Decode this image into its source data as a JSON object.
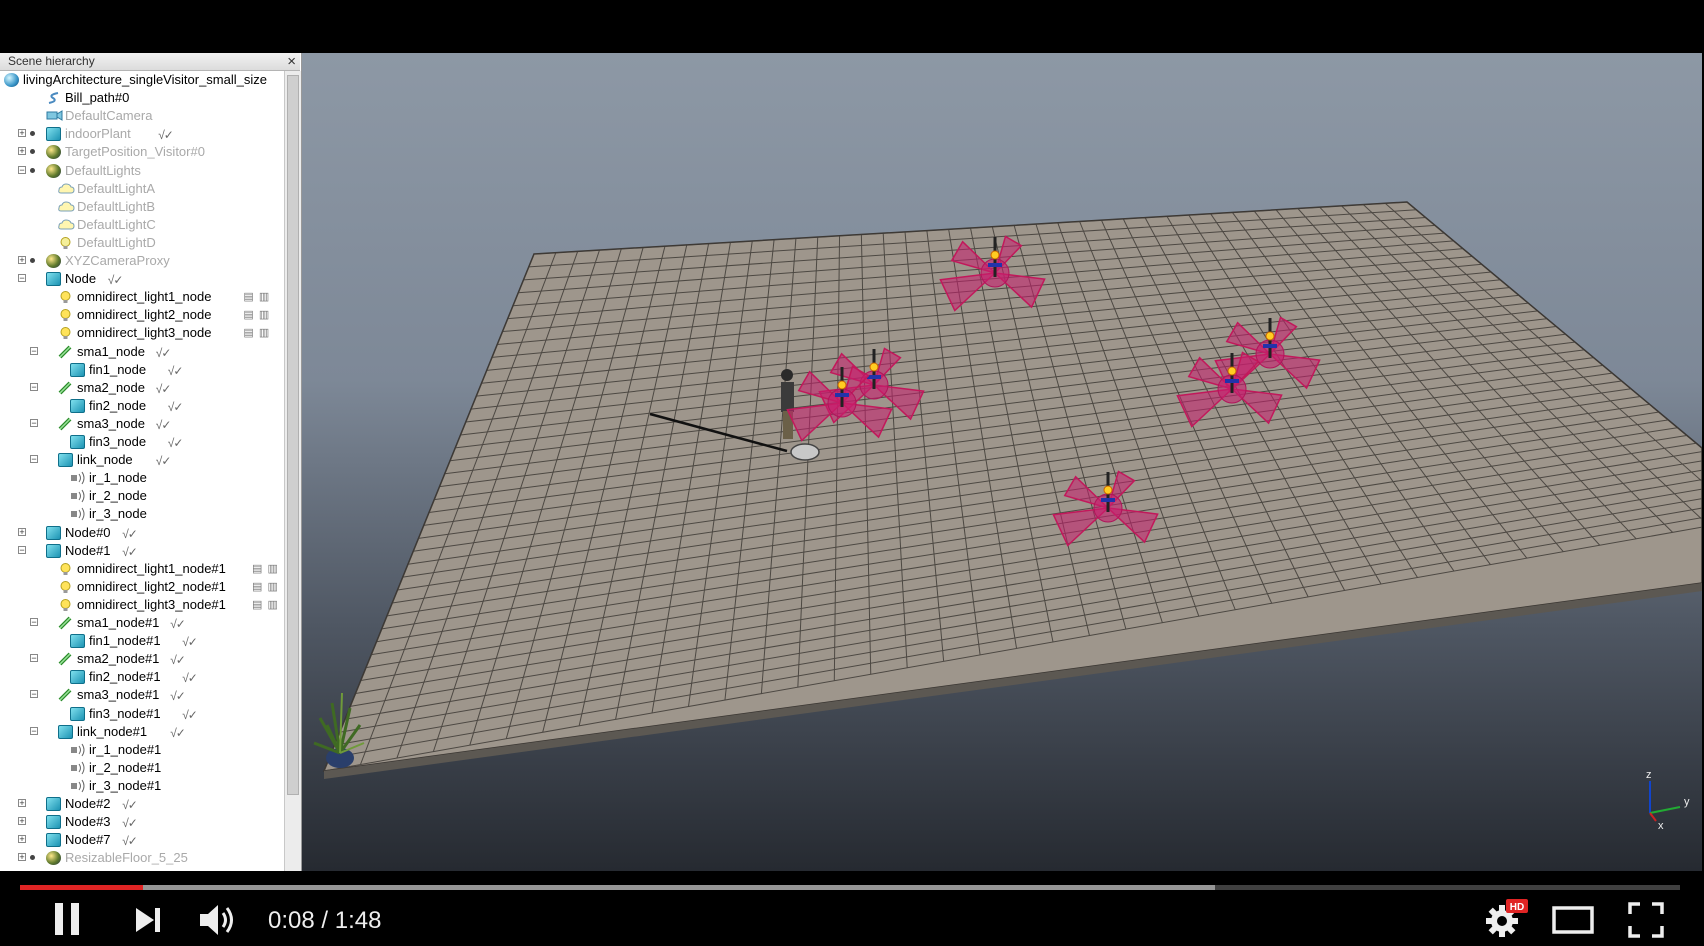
{
  "panel": {
    "title": "Scene hierarchy",
    "close_icon": "×"
  },
  "tree": [
    {
      "label": "livingArchitecture_singleVisitor_small_size",
      "depth": 0,
      "icon": "globe-icon",
      "expander": "",
      "greyed": false
    },
    {
      "label": "Bill_path#0",
      "depth": 2,
      "icon": "path-icon",
      "expander": "",
      "greyed": false
    },
    {
      "label": "DefaultCamera",
      "depth": 2,
      "icon": "camera-icon",
      "expander": "",
      "greyed": true
    },
    {
      "label": "indoorPlant",
      "depth": 2,
      "icon": "cube-icon",
      "expander": "+",
      "greyed": true,
      "flags": "√✓"
    },
    {
      "label": "TargetPosition_Visitor#0",
      "depth": 2,
      "icon": "sphere-icon",
      "expander": "+",
      "greyed": true
    },
    {
      "label": "DefaultLights",
      "depth": 2,
      "icon": "sphere-icon",
      "expander": "−",
      "greyed": true
    },
    {
      "label": "DefaultLightA",
      "depth": 3,
      "icon": "cloud-icon",
      "expander": "",
      "greyed": true
    },
    {
      "label": "DefaultLightB",
      "depth": 3,
      "icon": "cloud-icon",
      "expander": "",
      "greyed": true
    },
    {
      "label": "DefaultLightC",
      "depth": 3,
      "icon": "cloud-icon",
      "expander": "",
      "greyed": true
    },
    {
      "label": "DefaultLightD",
      "depth": 3,
      "icon": "bulb-icon",
      "expander": "",
      "greyed": true
    },
    {
      "label": "XYZCameraProxy",
      "depth": 2,
      "icon": "sphere-icon",
      "expander": "+",
      "greyed": true
    },
    {
      "label": "Node",
      "depth": 2,
      "icon": "cube-icon",
      "expander": "−",
      "greyed": false,
      "flags": "√✓"
    },
    {
      "label": "omnidirect_light1_node",
      "depth": 3,
      "icon": "bulb-icon",
      "expander": "",
      "greyed": false,
      "extra": "▤ ▥"
    },
    {
      "label": "omnidirect_light2_node",
      "depth": 3,
      "icon": "bulb-icon",
      "expander": "",
      "greyed": false,
      "extra": "▤ ▥"
    },
    {
      "label": "omnidirect_light3_node",
      "depth": 3,
      "icon": "bulb-icon",
      "expander": "",
      "greyed": false,
      "extra": "▤ ▥"
    },
    {
      "label": "sma1_node",
      "depth": 3,
      "icon": "muscle-icon",
      "expander": "−",
      "greyed": false,
      "flags": "√✓"
    },
    {
      "label": "fin1_node",
      "depth": 4,
      "icon": "cube-icon",
      "expander": "",
      "greyed": false,
      "flags": "√✓"
    },
    {
      "label": "sma2_node",
      "depth": 3,
      "icon": "muscle-icon",
      "expander": "−",
      "greyed": false,
      "flags": "√✓"
    },
    {
      "label": "fin2_node",
      "depth": 4,
      "icon": "cube-icon",
      "expander": "",
      "greyed": false,
      "flags": "√✓"
    },
    {
      "label": "sma3_node",
      "depth": 3,
      "icon": "muscle-icon",
      "expander": "−",
      "greyed": false,
      "flags": "√✓"
    },
    {
      "label": "fin3_node",
      "depth": 4,
      "icon": "cube-icon",
      "expander": "",
      "greyed": false,
      "flags": "√✓"
    },
    {
      "label": "link_node",
      "depth": 3,
      "icon": "cube-icon",
      "expander": "−",
      "greyed": false,
      "flags": "√✓"
    },
    {
      "label": "ir_1_node",
      "depth": 4,
      "icon": "sensor-icon",
      "expander": "",
      "greyed": false
    },
    {
      "label": "ir_2_node",
      "depth": 4,
      "icon": "sensor-icon",
      "expander": "",
      "greyed": false
    },
    {
      "label": "ir_3_node",
      "depth": 4,
      "icon": "sensor-icon",
      "expander": "",
      "greyed": false
    },
    {
      "label": "Node#0",
      "depth": 2,
      "icon": "cube-icon",
      "expander": "+",
      "greyed": false,
      "flags": "√✓"
    },
    {
      "label": "Node#1",
      "depth": 2,
      "icon": "cube-icon",
      "expander": "−",
      "greyed": false,
      "flags": "√✓"
    },
    {
      "label": "omnidirect_light1_node#1",
      "depth": 3,
      "icon": "bulb-icon",
      "expander": "",
      "greyed": false,
      "extra": "▤ ▥"
    },
    {
      "label": "omnidirect_light2_node#1",
      "depth": 3,
      "icon": "bulb-icon",
      "expander": "",
      "greyed": false,
      "extra": "▤ ▥"
    },
    {
      "label": "omnidirect_light3_node#1",
      "depth": 3,
      "icon": "bulb-icon",
      "expander": "",
      "greyed": false,
      "extra": "▤ ▥"
    },
    {
      "label": "sma1_node#1",
      "depth": 3,
      "icon": "muscle-icon",
      "expander": "−",
      "greyed": false,
      "flags": "√✓"
    },
    {
      "label": "fin1_node#1",
      "depth": 4,
      "icon": "cube-icon",
      "expander": "",
      "greyed": false,
      "flags": "√✓"
    },
    {
      "label": "sma2_node#1",
      "depth": 3,
      "icon": "muscle-icon",
      "expander": "−",
      "greyed": false,
      "flags": "√✓"
    },
    {
      "label": "fin2_node#1",
      "depth": 4,
      "icon": "cube-icon",
      "expander": "",
      "greyed": false,
      "flags": "√✓"
    },
    {
      "label": "sma3_node#1",
      "depth": 3,
      "icon": "muscle-icon",
      "expander": "−",
      "greyed": false,
      "flags": "√✓"
    },
    {
      "label": "fin3_node#1",
      "depth": 4,
      "icon": "cube-icon",
      "expander": "",
      "greyed": false,
      "flags": "√✓"
    },
    {
      "label": "link_node#1",
      "depth": 3,
      "icon": "cube-icon",
      "expander": "−",
      "greyed": false,
      "flags": "√✓"
    },
    {
      "label": "ir_1_node#1",
      "depth": 4,
      "icon": "sensor-icon",
      "expander": "",
      "greyed": false
    },
    {
      "label": "ir_2_node#1",
      "depth": 4,
      "icon": "sensor-icon",
      "expander": "",
      "greyed": false
    },
    {
      "label": "ir_3_node#1",
      "depth": 4,
      "icon": "sensor-icon",
      "expander": "",
      "greyed": false
    },
    {
      "label": "Node#2",
      "depth": 2,
      "icon": "cube-icon",
      "expander": "+",
      "greyed": false,
      "flags": "√✓"
    },
    {
      "label": "Node#3",
      "depth": 2,
      "icon": "cube-icon",
      "expander": "+",
      "greyed": false,
      "flags": "√✓"
    },
    {
      "label": "Node#7",
      "depth": 2,
      "icon": "cube-icon",
      "expander": "+",
      "greyed": false,
      "flags": "√✓"
    },
    {
      "label": "ResizableFloor_5_25",
      "depth": 2,
      "icon": "sphere-icon",
      "expander": "+",
      "greyed": true
    }
  ],
  "viewport": {
    "axis_labels": {
      "z": "z",
      "y": "y",
      "x": "x"
    }
  },
  "player": {
    "current_time": "0:08",
    "duration": "1:48",
    "time_text": "0:08 / 1:48",
    "progress_played": 0.074,
    "progress_buffered": 0.72,
    "hd_badge": "HD",
    "colors": {
      "played": "#e02424",
      "hd_badge": "#e02424"
    },
    "icons": [
      "pause-icon",
      "next-icon",
      "volume-icon",
      "settings-icon",
      "theater-icon",
      "fullscreen-icon"
    ]
  }
}
